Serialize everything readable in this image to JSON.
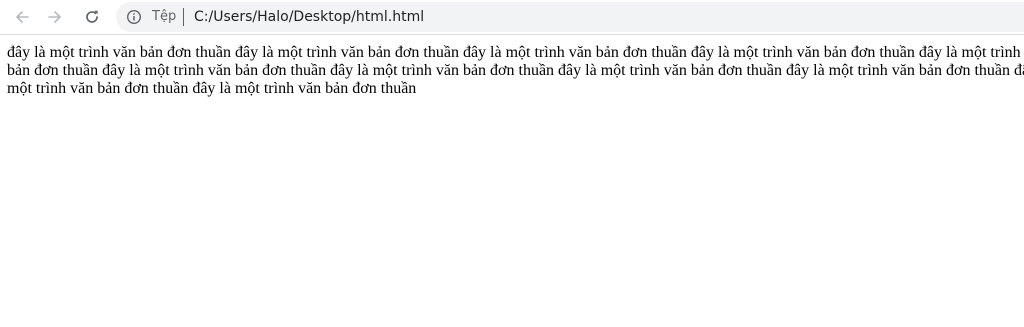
{
  "toolbar": {
    "site_label": "Tệp",
    "url": "C:/Users/Halo/Desktop/html.html"
  },
  "page": {
    "text": "đây là một trình văn bản đơn thuần đây là một trình văn bản đơn thuần đây là một trình văn bản đơn thuần đây là một trình văn bản đơn thuần đây là một trình văn bản đơn thuần đây là một trình văn bản đơn thuần đây là một trình văn bản đơn thuần đây là một trình văn bản đơn thuần đây là một trình văn bản đơn thuần đây là một trình văn bản đơn thuần đây là một trình văn bản đơn thuần"
  }
}
